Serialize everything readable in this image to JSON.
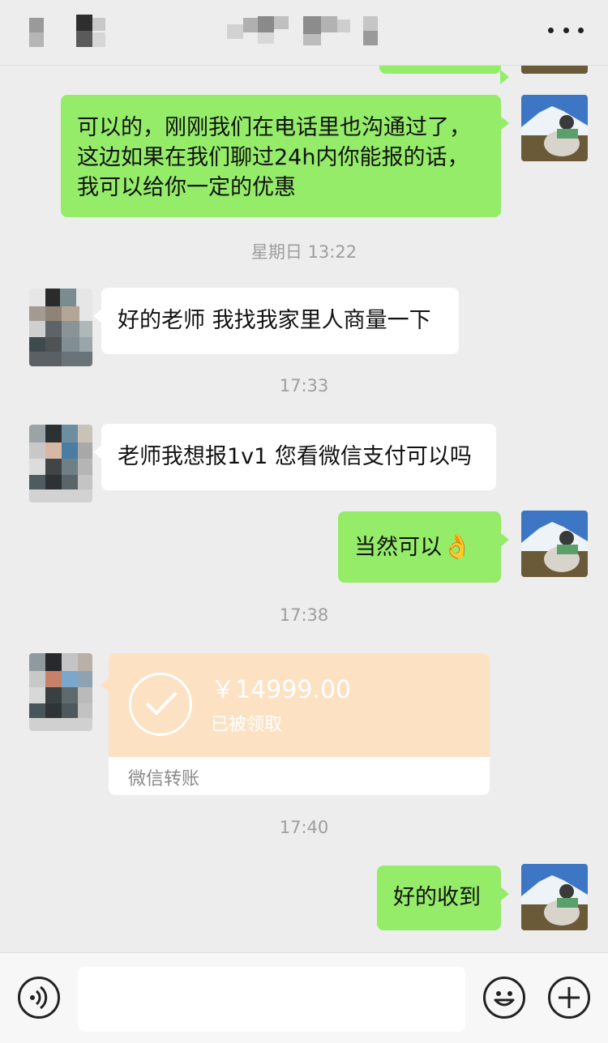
{
  "header": {
    "more_icon": "more-dots-icon"
  },
  "messages": {
    "m1": "可以的，刚刚我们在电话里也沟通过了，这边如果在我们聊过24h内你能报的话，我可以给你一定的优惠",
    "t1": "星期日 13:22",
    "m2": "好的老师 我找我家里人商量一下",
    "t2": "17:33",
    "m3": "老师我想报1v1 您看微信支付可以吗",
    "m4": "当然可以",
    "m4_emoji": "👌",
    "t3": "17:38",
    "transfer": {
      "amount": "￥14999.00",
      "status": "已被领取",
      "label": "微信转账"
    },
    "t4": "17:40",
    "m5": "好的收到"
  },
  "input_bar": {
    "voice_icon": "voice-icon",
    "emoji_icon": "emoji-icon",
    "plus_icon": "plus-icon",
    "placeholder": ""
  },
  "colors": {
    "background": "#ededed",
    "outgoing_bubble": "#95ec69",
    "incoming_bubble": "#ffffff",
    "transfer_card": "#fde1c3",
    "timestamp": "#9e9e9e"
  }
}
